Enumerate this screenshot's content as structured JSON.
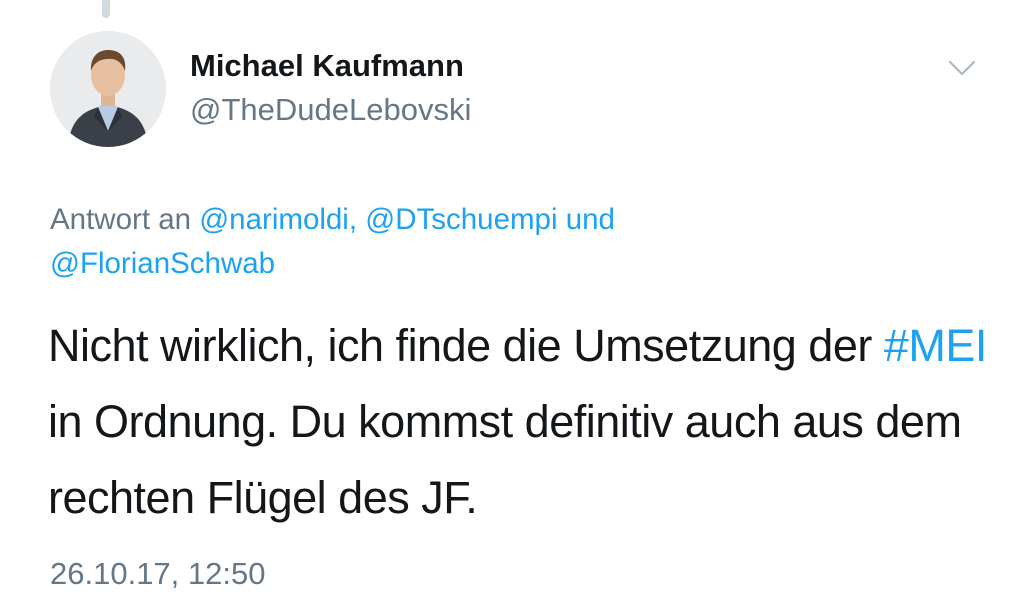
{
  "tweet": {
    "author": {
      "name": "Michael Kaufmann",
      "handle": "@TheDudeLebovski"
    },
    "menu_icon": "chevron-down-icon",
    "reply_to": {
      "prefix": "Antwort an",
      "user1": "@narimoldi,",
      "user2": "@DTschuempi",
      "conjunction": "und",
      "user3": "@FlorianSchwab"
    },
    "text": {
      "part1": "Nicht wirklich, ich finde die Umsetzung der",
      "hashtag": "#MEI",
      "part2": "in Ordnung. Du kommst definitiv auch aus dem rechten Flügel des JF."
    },
    "timestamp": "26.10.17, 12:50"
  },
  "colors": {
    "link": "#1da1f2",
    "secondary_text": "#657786",
    "primary_text": "#14171a",
    "thread_line": "#cfd9de"
  }
}
